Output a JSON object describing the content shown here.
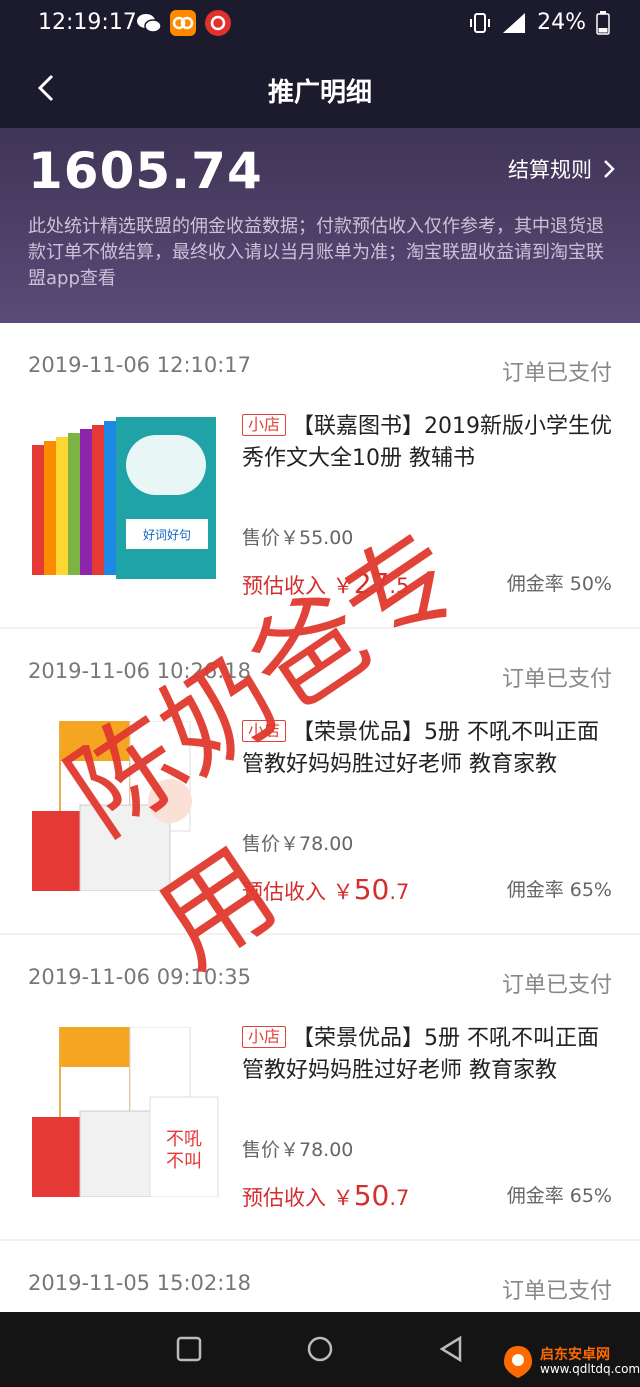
{
  "status_bar": {
    "time": "12:19:17",
    "battery": "24%",
    "network": "4G"
  },
  "nav": {
    "title": "推广明细"
  },
  "summary": {
    "amount": "1605.74",
    "rules_label": "结算规则",
    "note": "此处统计精选联盟的佣金收益数据；付款预估收入仅作参考，其中退货退款订单不做结算，最终收入请以当月账单为准；淘宝联盟收益请到淘宝联盟app查看"
  },
  "orders": [
    {
      "datetime": "2019-11-06 12:10:17",
      "status": "订单已支付",
      "tag": "小店",
      "title": "【联嘉图书】2019新版小学生优秀作文大全10册 教辅书",
      "price": "售价￥55.00",
      "estimated_label": "预估收入 ￥",
      "estimated_int": "27",
      "estimated_dec": ".5",
      "commission_rate": "佣金率 50%"
    },
    {
      "datetime": "2019-11-06 10:26:18",
      "status": "订单已支付",
      "tag": "小店",
      "title": "【荣景优品】5册 不吼不叫正面管教好妈妈胜过好老师 教育家教",
      "price": "售价￥78.00",
      "estimated_label": "预估收入 ￥",
      "estimated_int": "50",
      "estimated_dec": ".7",
      "commission_rate": "佣金率 65%"
    },
    {
      "datetime": "2019-11-06 09:10:35",
      "status": "订单已支付",
      "tag": "小店",
      "title": "【荣景优品】5册 不吼不叫正面管教好妈妈胜过好老师 教育家教",
      "price": "售价￥78.00",
      "estimated_label": "预估收入 ￥",
      "estimated_int": "50",
      "estimated_dec": ".7",
      "commission_rate": "佣金率 65%"
    },
    {
      "datetime": "2019-11-05 15:02:18",
      "status": "订单已支付"
    }
  ],
  "stamp": {
    "text": "陈奶爸专用",
    "color": "#e0392f"
  },
  "watermark": {
    "title": "启东安卓网",
    "url": "www.qdltdq.com"
  },
  "colors": {
    "header_bg": "#1c1b2e",
    "accent_red": "#d32f2f"
  }
}
